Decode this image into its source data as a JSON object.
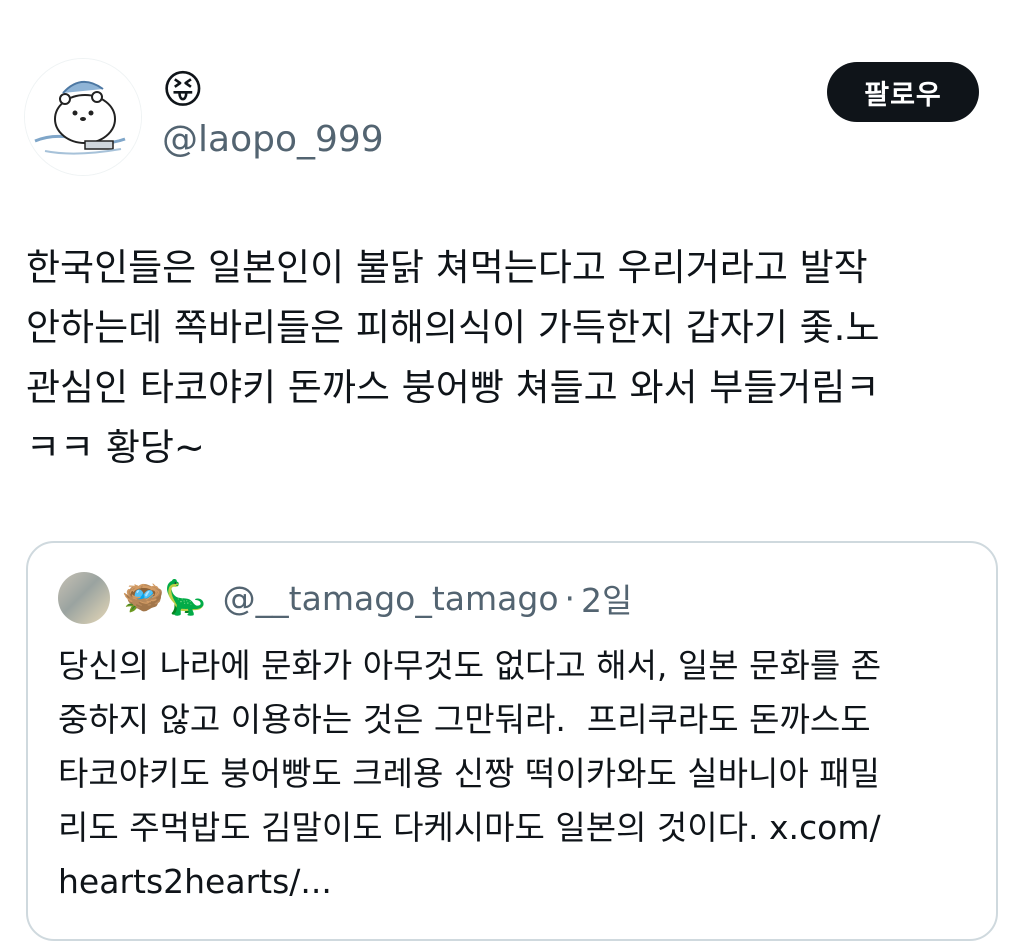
{
  "author": {
    "display_name": "😝",
    "handle": "@laopo_999"
  },
  "follow_button": {
    "label": "팔로우"
  },
  "tweet": {
    "text": "한국인들은 일본인이 불닭 쳐먹는다고 우리거라고 발작\n안하는데 쪽바리들은 피해의식이 가득한지 갑자기 좇.노\n관심인 타코야키 돈까스 붕어빵 쳐들고 와서 부들거림ㅋ\nㅋㅋ 황당~"
  },
  "quote": {
    "emojis": "🪺🦕",
    "handle": "@__tamago_tamago",
    "separator": "·",
    "time": "2일",
    "text": "당신의 나라에 문화가 아무것도 없다고 해서, 일본 문화를 존\n중하지 않고 이용하는 것은 그만둬라.  프리쿠라도 돈까스도\n타코야키도 붕어빵도 크레용 신짱 떡이카와도 실바니아 패밀\n리도 주먹밥도 김말이도 다케시마도 일본의 것이다. x.com/\nhearts2hearts/..."
  }
}
